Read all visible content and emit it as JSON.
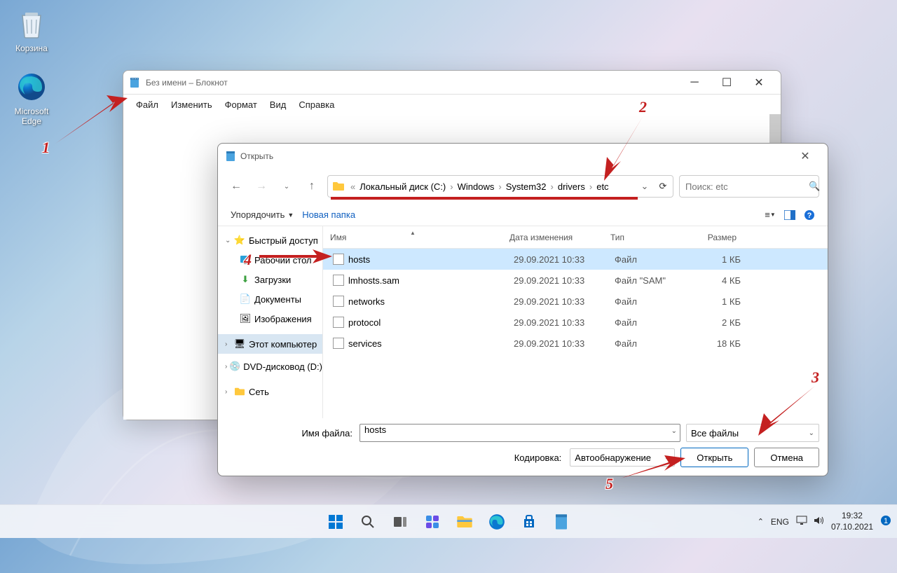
{
  "desktop": {
    "recycle_bin": "Корзина",
    "edge": "Microsoft Edge"
  },
  "notepad": {
    "title": "Без имени – Блокнот",
    "menu": {
      "file": "Файл",
      "edit": "Изменить",
      "format": "Формат",
      "view": "Вид",
      "help": "Справка"
    }
  },
  "dialog": {
    "title": "Открыть",
    "breadcrumb": {
      "prefix": "«",
      "p1": "Локальный диск (C:)",
      "p2": "Windows",
      "p3": "System32",
      "p4": "drivers",
      "p5": "etc"
    },
    "search_placeholder": "Поиск: etc",
    "toolbar": {
      "organize": "Упорядочить",
      "newfolder": "Новая папка"
    },
    "tree": {
      "quick": "Быстрый доступ",
      "desktop": "Рабочий стол",
      "downloads": "Загрузки",
      "documents": "Документы",
      "pictures": "Изображения",
      "thispc": "Этот компьютер",
      "dvd": "DVD-дисковод (D:)",
      "network": "Сеть"
    },
    "columns": {
      "name": "Имя",
      "date": "Дата изменения",
      "type": "Тип",
      "size": "Размер"
    },
    "files": [
      {
        "name": "hosts",
        "date": "29.09.2021 10:33",
        "type": "Файл",
        "size": "1 КБ",
        "selected": true
      },
      {
        "name": "lmhosts.sam",
        "date": "29.09.2021 10:33",
        "type": "Файл \"SAM\"",
        "size": "4 КБ",
        "selected": false
      },
      {
        "name": "networks",
        "date": "29.09.2021 10:33",
        "type": "Файл",
        "size": "1 КБ",
        "selected": false
      },
      {
        "name": "protocol",
        "date": "29.09.2021 10:33",
        "type": "Файл",
        "size": "2 КБ",
        "selected": false
      },
      {
        "name": "services",
        "date": "29.09.2021 10:33",
        "type": "Файл",
        "size": "18 КБ",
        "selected": false
      }
    ],
    "footer": {
      "filename_label": "Имя файла:",
      "filename_value": "hosts",
      "filter": "Все файлы",
      "encoding_label": "Кодировка:",
      "encoding_value": "Автообнаружение",
      "open": "Открыть",
      "cancel": "Отмена"
    }
  },
  "taskbar": {
    "lang": "ENG",
    "time": "19:32",
    "date": "07.10.2021"
  },
  "annotations": {
    "n1": "1",
    "n2": "2",
    "n3": "3",
    "n4": "4",
    "n5": "5"
  }
}
